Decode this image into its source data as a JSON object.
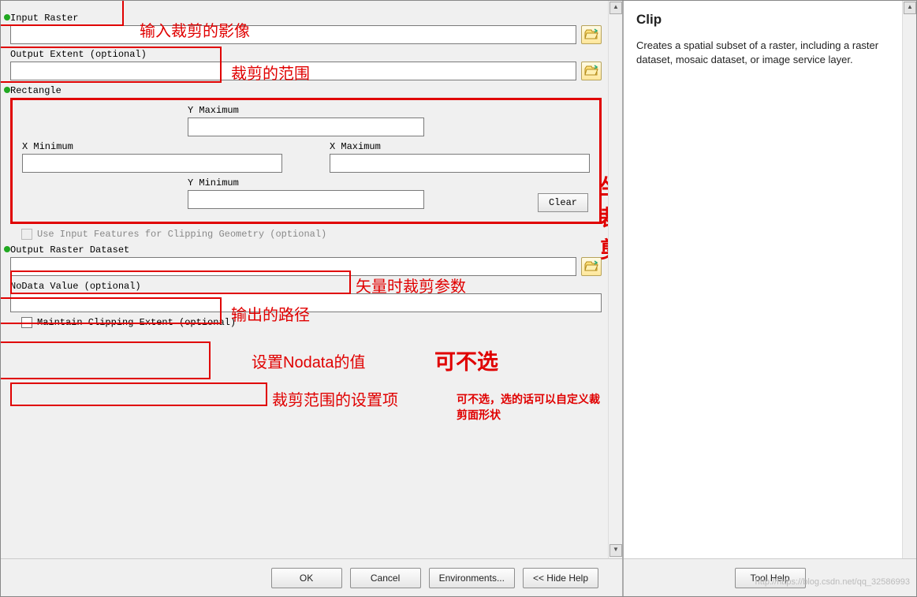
{
  "help": {
    "title": "Clip",
    "description": "Creates a spatial subset of a raster, including a raster dataset, mosaic dataset, or image service layer."
  },
  "fields": {
    "input_raster_label": "Input Raster",
    "output_extent_label": "Output Extent (optional)",
    "rectangle_label": "Rectangle",
    "y_max_label": "Y Maximum",
    "x_min_label": "X Minimum",
    "x_max_label": "X Maximum",
    "y_min_label": "Y Minimum",
    "clear_label": "Clear",
    "use_input_features_label": "Use Input Features for Clipping Geometry (optional)",
    "output_raster_label": "Output Raster Dataset",
    "nodata_label": "NoData Value (optional)",
    "maintain_extent_label": "Maintain Clipping Extent (optional)"
  },
  "values": {
    "input_raster": "",
    "output_extent": "",
    "y_max": "",
    "x_min": "",
    "x_max": "",
    "y_min": "",
    "output_raster": "",
    "nodata": ""
  },
  "buttons": {
    "ok": "OK",
    "cancel": "Cancel",
    "environments": "Environments...",
    "hide_help": "<< Hide Help",
    "tool_help": "Tool Help"
  },
  "annotations": {
    "input_raster": "输入裁剪的影像",
    "output_extent": "裁剪的范围",
    "coord_clip": "坐标裁剪！",
    "vector_param": "矢量时裁剪参数",
    "output_path": "输出的路径",
    "nodata_set": "设置Nodata的值",
    "optional_big": "可不选",
    "maintain_ext": "裁剪范围的设置项",
    "maintain_ext_note": "可不选，选的话可以自定义裁剪面形状"
  },
  "watermark": "http://https://blog.csdn.net/qq_32586993"
}
